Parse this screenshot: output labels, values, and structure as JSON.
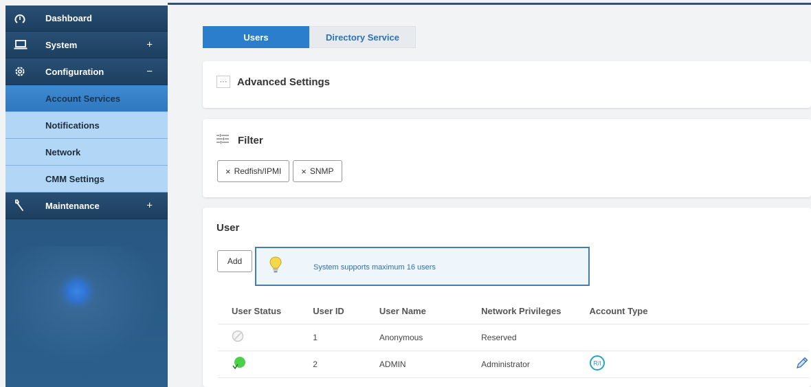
{
  "sidebar": {
    "dashboard": {
      "label": "Dashboard",
      "icon": "dashboard-gauge-icon"
    },
    "system": {
      "label": "System",
      "icon": "laptop-icon",
      "toggle": "+"
    },
    "configuration": {
      "label": "Configuration",
      "icon": "gear-icon",
      "toggle": "−"
    },
    "sub_items": [
      {
        "label": "Account Services",
        "active": true
      },
      {
        "label": "Notifications",
        "active": false
      },
      {
        "label": "Network",
        "active": false
      },
      {
        "label": "CMM Settings",
        "active": false
      }
    ],
    "maintenance": {
      "label": "Maintenance",
      "icon": "wrench-icon",
      "toggle": "+"
    }
  },
  "tabs": [
    {
      "label": "Users",
      "active": true
    },
    {
      "label": "Directory Service",
      "active": false
    }
  ],
  "advanced": {
    "dots": "···",
    "title": "Advanced Settings"
  },
  "filter": {
    "title": "Filter",
    "chips": [
      {
        "x": "×",
        "label": "Redfish/IPMI"
      },
      {
        "x": "×",
        "label": "SNMP"
      }
    ]
  },
  "user_section": {
    "title": "User",
    "add_label": "Add",
    "notice": "System supports maximum 16 users",
    "columns": [
      "User Status",
      "User ID",
      "User Name",
      "Network Privileges",
      "Account Type"
    ],
    "rows": [
      {
        "status": "disabled",
        "id": "1",
        "name": "Anonymous",
        "privileges": "Reserved",
        "account_type": ""
      },
      {
        "status": "enabled",
        "id": "2",
        "name": "ADMIN",
        "privileges": "Administrator",
        "account_type": "R/I"
      }
    ]
  },
  "colors": {
    "accent": "#2a7ecb",
    "sidebar": "#27557f",
    "active_sub": "#3e8ad0",
    "sub_bg": "#b2d6f5"
  }
}
